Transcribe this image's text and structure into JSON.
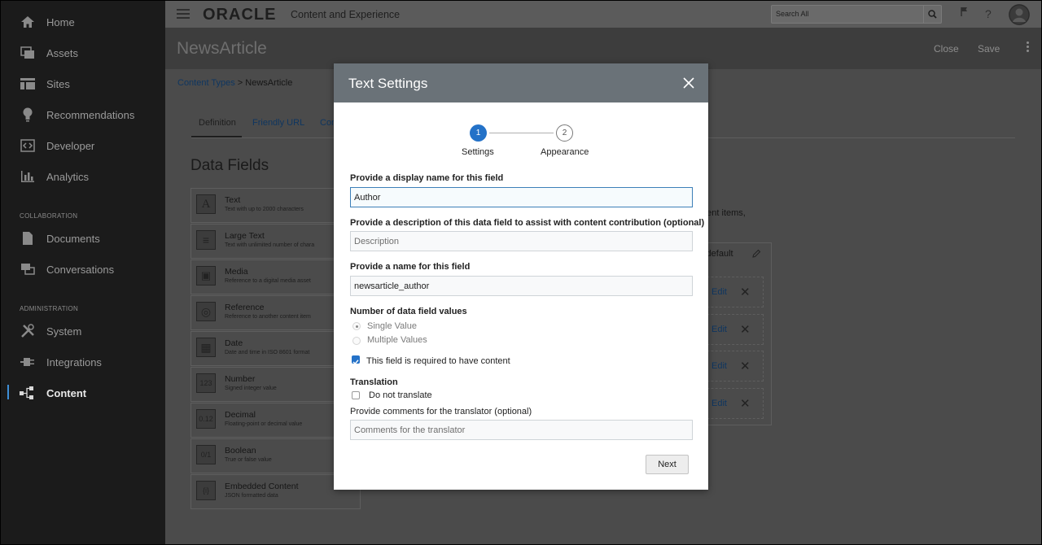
{
  "sidebar": {
    "items": [
      {
        "label": "Home",
        "icon": "home-icon"
      },
      {
        "label": "Assets",
        "icon": "assets-icon"
      },
      {
        "label": "Sites",
        "icon": "sites-icon"
      },
      {
        "label": "Recommendations",
        "icon": "lightbulb-icon"
      },
      {
        "label": "Developer",
        "icon": "code-icon"
      },
      {
        "label": "Analytics",
        "icon": "analytics-icon"
      }
    ],
    "collaboration_label": "COLLABORATION",
    "collab_items": [
      {
        "label": "Documents",
        "icon": "documents-icon"
      },
      {
        "label": "Conversations",
        "icon": "conversations-icon"
      }
    ],
    "administration_label": "ADMINISTRATION",
    "admin_items": [
      {
        "label": "System",
        "icon": "tools-icon"
      },
      {
        "label": "Integrations",
        "icon": "plug-icon"
      },
      {
        "label": "Content",
        "icon": "content-icon"
      }
    ]
  },
  "topbar": {
    "logo": "ORACLE",
    "product": "Content and Experience",
    "search_placeholder": "Search All"
  },
  "page": {
    "title": "NewsArticle",
    "close_label": "Close",
    "save_label": "Save"
  },
  "breadcrumb": {
    "link": "Content Types",
    "separator": ">",
    "current": "NewsArticle"
  },
  "tabs": [
    "Definition",
    "Friendly URL",
    "Con"
  ],
  "data_fields_title": "Data Fields",
  "field_types": [
    {
      "name": "Text",
      "desc": "Text with up to 2000 characters",
      "icon": "A"
    },
    {
      "name": "Large Text",
      "desc": "Text with unlimited number of chara",
      "icon": "≡"
    },
    {
      "name": "Media",
      "desc": "Reference to a digital media asset",
      "icon": "▣"
    },
    {
      "name": "Reference",
      "desc": "Reference to another content item",
      "icon": "◎"
    },
    {
      "name": "Date",
      "desc": "Date and time in ISO 8601 format",
      "icon": "▦"
    },
    {
      "name": "Number",
      "desc": "Signed integer value",
      "icon": "123"
    },
    {
      "name": "Decimal",
      "desc": "Floating-point or decimal value",
      "icon": "0.12"
    },
    {
      "name": "Boolean",
      "desc": "True or false value",
      "icon": "0/1"
    },
    {
      "name": "Embedded Content",
      "desc": "JSON formatted data",
      "icon": "{i}"
    }
  ],
  "bg_text": {
    "content_items": "ntent items,",
    "by_default": "y default"
  },
  "edit_label": "Edit",
  "modal": {
    "title": "Text Settings",
    "steps": [
      {
        "number": "1",
        "label": "Settings"
      },
      {
        "number": "2",
        "label": "Appearance"
      }
    ],
    "display_name_label": "Provide a display name for this field",
    "display_name_value": "Author",
    "description_label": "Provide a description of this data field to assist with content contribution (optional)",
    "description_placeholder": "Description",
    "name_label": "Provide a name for this field",
    "name_value": "newsarticle_author",
    "values_label": "Number of data field values",
    "single_value": "Single Value",
    "multiple_values": "Multiple Values",
    "required_label": "This field is required to have content",
    "required_checked": true,
    "translation_label": "Translation",
    "do_not_translate": "Do not translate",
    "do_not_translate_checked": false,
    "comments_label": "Provide comments for the translator (optional)",
    "comments_placeholder": "Comments for the translator",
    "next_label": "Next"
  },
  "colors": {
    "sidebar_bg": "#1b1b1b",
    "modal_header": "#6a7278",
    "accent": "#2472c8"
  }
}
